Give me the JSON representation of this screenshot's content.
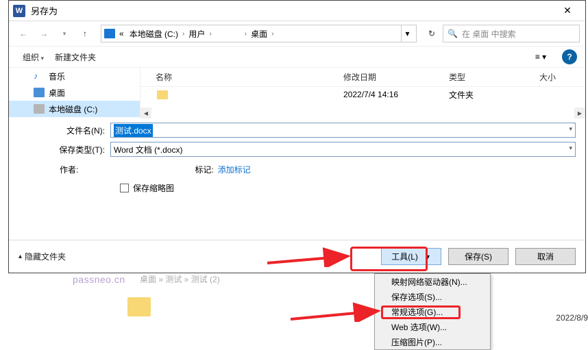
{
  "title": "另存为",
  "breadcrumb": {
    "root": "«",
    "drive": "本地磁盘 (C:)",
    "users": "用户",
    "blank": "",
    "desktop": "桌面"
  },
  "search_placeholder": "在 桌面 中搜索",
  "toolbar": {
    "organize": "组织",
    "newfolder": "新建文件夹"
  },
  "sidebar": {
    "music": "音乐",
    "desktop": "桌面",
    "disk": "本地磁盘 (C:)"
  },
  "list": {
    "header": {
      "name": "名称",
      "date": "修改日期",
      "type": "类型",
      "size": "大小"
    },
    "row": {
      "name": "",
      "date": "2022/7/4 14:16",
      "type": "文件夹"
    }
  },
  "form": {
    "filename_label": "文件名(N):",
    "filename_value": "测试.docx",
    "filetype_label": "保存类型(T):",
    "filetype_value": "Word 文档 (*.docx)",
    "author_label": "作者:",
    "author_value": "",
    "tag_label": "标记:",
    "tag_value": "添加标记",
    "thumbnail_label": "保存缩略图"
  },
  "footer": {
    "hide": "隐藏文件夹",
    "tools": "工具(L)",
    "save": "保存(S)",
    "cancel": "取消"
  },
  "tools_menu": {
    "map_drive": "映射网络驱动器(N)...",
    "save_opts": "保存选项(S)...",
    "general_opts": "常规选项(G)...",
    "web_opts": "Web 选项(W)...",
    "compress": "压缩图片(P)..."
  },
  "bg": {
    "crumb": "桌面 » 测试 » 测试 (2)",
    "date": "2022/8/9"
  },
  "watermark": "passneo.cn"
}
